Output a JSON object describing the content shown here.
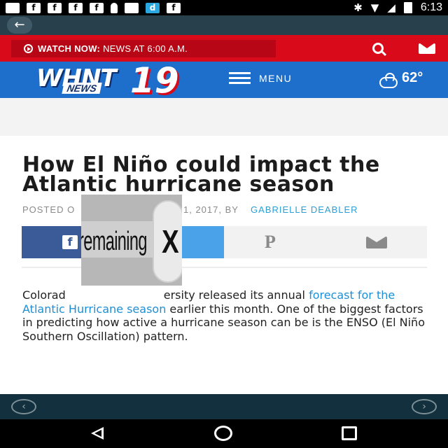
{
  "status_bar": {
    "time": "6:13",
    "icons": [
      "messages-icon",
      "facebook-icon",
      "facebook-icon",
      "facebook-icon",
      "facebook-icon",
      "vlc-icon",
      "card-icon",
      "dailyhunt-icon",
      "facebook-icon",
      "sync-icon",
      "bluetooth-icon",
      "wifi-icon",
      "no-signal-icon",
      "battery-icon"
    ]
  },
  "app_bar": {
    "back_icon": "arrow-left-icon"
  },
  "top_bar": {
    "watch_now": "WATCH NOW:",
    "watch_detail": "NEWS AT 6:00 A.M.",
    "accent": "#d90a1a"
  },
  "brand": {
    "logo_whnt": "WHNT",
    "logo_news": "NEWS",
    "logo_number": "19",
    "menu_label": "MENU",
    "temperature": "62°",
    "accent": "#1e6fcc"
  },
  "article": {
    "headline": "How El Niño could impact the Atlantic hurricane season",
    "byline_posted": "POSTED O",
    "byline_date": "1, 2017, BY",
    "byline_author": "GABRIELLE DEABLER",
    "body_lead": "Colorad",
    "body_lead_rest": "ersity released its annual",
    "body_link": "forecast for the Atlantic Hurricane season",
    "body_rest": " earlier this month. One of the biggest factors in predicting how active a hurricane season can be is the ENSO (El Niño Southern Oscillation) pattern."
  },
  "overlay": {
    "remaining_label": "remaining",
    "close_label": "X"
  },
  "share": {
    "facebook": "f"
  }
}
